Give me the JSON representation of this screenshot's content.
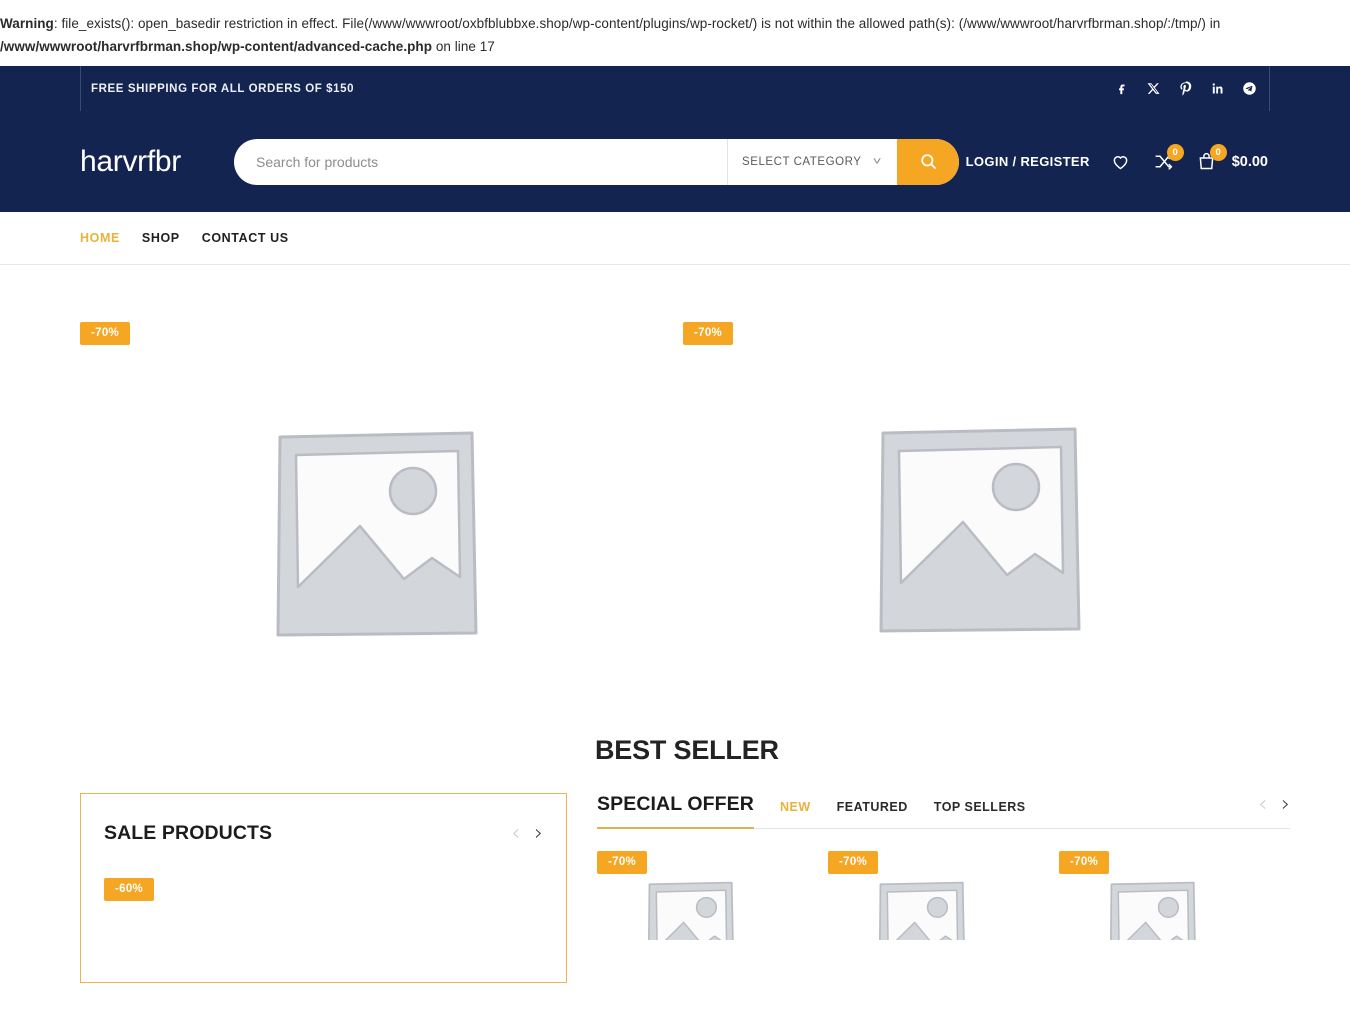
{
  "warning": {
    "label": "Warning",
    "line1": ": file_exists(): open_basedir restriction in effect. File(/www/wwwroot/oxbfblubbxe.shop/wp-content/plugins/wp-rocket/) is not within the allowed path(s): (/www/wwwroot/harvrfbrman.shop/:/tmp/) in",
    "line2_path": "/www/wwwroot/harvrfbrman.shop/wp-content/advanced-cache.php",
    "line2_tail": " on line 17"
  },
  "topbar": {
    "message": "FREE SHIPPING FOR ALL ORDERS OF $150",
    "socials": [
      {
        "name": "facebook-icon"
      },
      {
        "name": "x-twitter-icon"
      },
      {
        "name": "pinterest-icon"
      },
      {
        "name": "linkedin-icon"
      },
      {
        "name": "telegram-icon"
      }
    ]
  },
  "header": {
    "logo": "harvrfbr",
    "search_placeholder": "Search for products",
    "search_value": "",
    "category_label": "SELECT CATEGORY",
    "login_label": "LOGIN / REGISTER",
    "wishlist_badge": "",
    "compare_badge": "0",
    "cart_badge": "0",
    "cart_total": "$0.00"
  },
  "nav": {
    "items": [
      {
        "label": "HOME",
        "active": true
      },
      {
        "label": "SHOP",
        "active": false
      },
      {
        "label": "CONTACT US",
        "active": false
      }
    ]
  },
  "hero": {
    "badges": [
      {
        "label": "-70%"
      },
      {
        "label": "-70%"
      }
    ]
  },
  "sections": {
    "best_seller_title": "BEST SELLER",
    "sale_products": {
      "title": "SALE PRODUCTS",
      "prev": "‹",
      "next": "›",
      "badges": [
        {
          "label": "-60%"
        }
      ]
    },
    "special_offer": {
      "title": "SPECIAL OFFER",
      "tabs": [
        {
          "label": "NEW",
          "active": true
        },
        {
          "label": "FEATURED",
          "active": false
        },
        {
          "label": "TOP SELLERS",
          "active": false
        }
      ],
      "prev": "‹",
      "next": "›",
      "cards": [
        {
          "badge": "-70%"
        },
        {
          "badge": "-70%"
        },
        {
          "badge": "-70%"
        }
      ]
    }
  },
  "colors": {
    "header_navy": "#132450",
    "accent_orange": "#f5a623",
    "accent_gold": "#e8b33a"
  }
}
